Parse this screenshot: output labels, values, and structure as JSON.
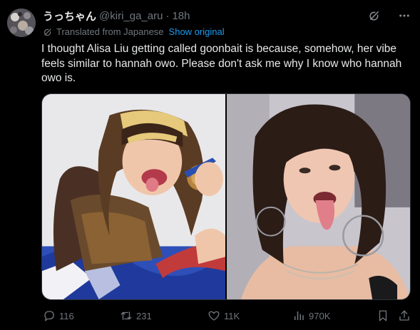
{
  "author": {
    "display_name": "うっちゃん",
    "handle": "@kiri_ga_aru",
    "separator": "·",
    "time": "18h"
  },
  "translation": {
    "label": "Translated from Japanese",
    "show_original": "Show original"
  },
  "tweet": {
    "text": "I thought Alisa Liu getting called goonbait is because, somehow, her vibe feels similar to hannah owo. Please don't ask me why I know who hannah owo is."
  },
  "actions": {
    "replies": "116",
    "retweets": "231",
    "likes": "11K",
    "views": "970K"
  },
  "icons": {
    "grok": "grok-icon",
    "more": "more-icon",
    "translate": "translate-icon",
    "reply": "reply-icon",
    "retweet": "retweet-icon",
    "like": "heart-icon",
    "views": "views-icon",
    "bookmark": "bookmark-icon",
    "share": "share-icon"
  },
  "colors": {
    "background": "#000000",
    "text": "#e7e9ea",
    "muted": "#71767b",
    "link": "#1d9bf0"
  }
}
